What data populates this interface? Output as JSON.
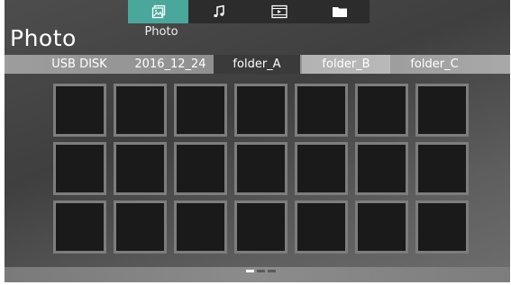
{
  "media_tabs": [
    {
      "id": "photo",
      "icon": "photo-icon",
      "active": true
    },
    {
      "id": "music",
      "icon": "music-note-icon",
      "active": false
    },
    {
      "id": "video",
      "icon": "film-icon",
      "active": false
    },
    {
      "id": "folder",
      "icon": "folder-icon",
      "active": false
    }
  ],
  "active_tab_caption": "Photo",
  "page_title": "Photo",
  "path": [
    {
      "label": "USB DISK",
      "state": "normal"
    },
    {
      "label": "2016_12_24",
      "state": "normal"
    },
    {
      "label": "folder_A",
      "state": "selected"
    },
    {
      "label": "folder_B",
      "state": "highlight"
    },
    {
      "label": "folder_C",
      "state": "normal"
    }
  ],
  "grid": {
    "rows": 3,
    "columns": 7
  },
  "pagination": {
    "pages": 3,
    "current": 1
  },
  "colors": {
    "accent": "#4aa79b",
    "tab_bar": "#2c2c2c",
    "thumb_fill": "#1a1a1a",
    "thumb_border": "#7d7d7d"
  }
}
